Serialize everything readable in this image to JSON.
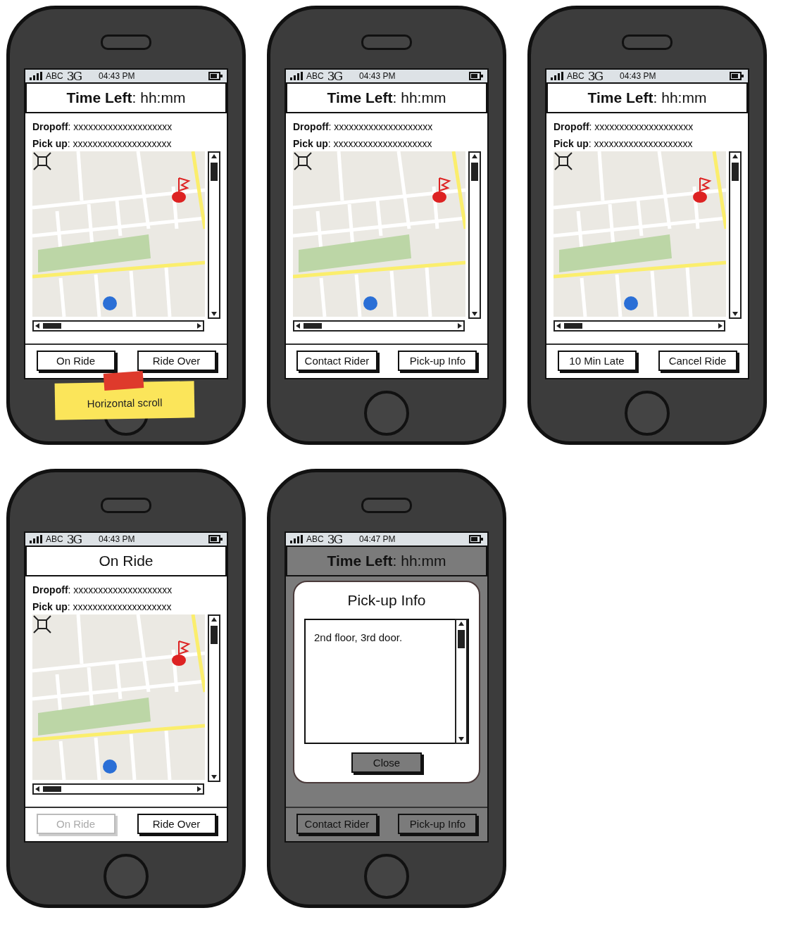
{
  "phones": [
    {
      "status": {
        "carrier": "ABC",
        "network": "3G",
        "time": "04:43 PM"
      },
      "title": "**Time Left**: hh:mm",
      "dimmed": false,
      "details": [
        "**Dropoff**: xxxxxxxxxxxxxxxxxxxx",
        "**Pick up**: xxxxxxxxxxxxxxxxxxxx"
      ],
      "map": true,
      "buttons": [
        {
          "label": "On Ride",
          "disabled": false
        },
        {
          "label": "Ride Over",
          "disabled": false
        }
      ],
      "note": "Horizontal scroll"
    },
    {
      "status": {
        "carrier": "ABC",
        "network": "3G",
        "time": "04:43 PM"
      },
      "title": "**Time Left**: hh:mm",
      "dimmed": false,
      "details": [
        "**Dropoff**: xxxxxxxxxxxxxxxxxxxx",
        "**Pick up**: xxxxxxxxxxxxxxxxxxxx"
      ],
      "map": true,
      "buttons": [
        {
          "label": "Contact Rider",
          "disabled": false
        },
        {
          "label": "Pick-up Info",
          "disabled": false
        }
      ]
    },
    {
      "status": {
        "carrier": "ABC",
        "network": "3G",
        "time": "04:43 PM"
      },
      "title": "**Time Left**: hh:mm",
      "dimmed": false,
      "details": [
        "**Dropoff**: xxxxxxxxxxxxxxxxxxxx",
        "**Pick up**: xxxxxxxxxxxxxxxxxxxx"
      ],
      "map": true,
      "buttons": [
        {
          "label": "10 Min Late",
          "disabled": false
        },
        {
          "label": "Cancel Ride",
          "disabled": false
        }
      ]
    },
    {
      "status": {
        "carrier": "ABC",
        "network": "3G",
        "time": "04:43 PM"
      },
      "title": "On Ride",
      "dimmed": false,
      "details": [
        "**Dropoff**: xxxxxxxxxxxxxxxxxxxx",
        "**Pick up**: xxxxxxxxxxxxxxxxxxxx"
      ],
      "map": true,
      "buttons": [
        {
          "label": "On Ride",
          "disabled": true
        },
        {
          "label": "Ride Over",
          "disabled": false
        }
      ]
    },
    {
      "status": {
        "carrier": "ABC",
        "network": "3G",
        "time": "04:47 PM"
      },
      "title": "**Time Left**: hh:mm",
      "dimmed": true,
      "buttons": [
        {
          "label": "Contact Rider",
          "disabled": false
        },
        {
          "label": "Pick-up Info",
          "disabled": false
        }
      ],
      "dialog": {
        "title": "Pick-up Info",
        "text": "2nd floor, 3rd door.",
        "button": "Close"
      }
    }
  ]
}
